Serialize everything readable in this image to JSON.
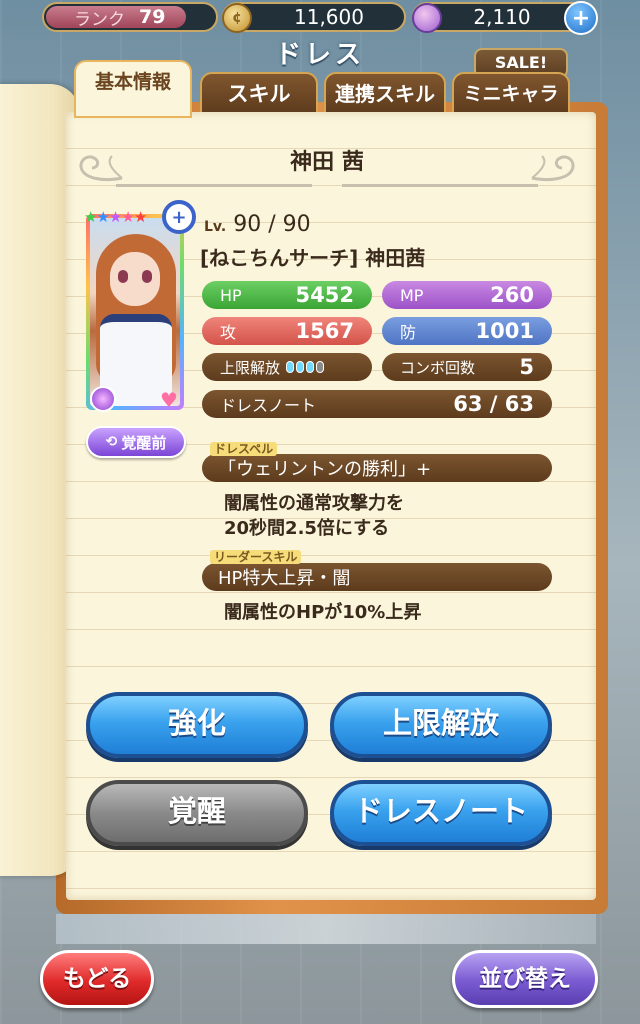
{
  "header": {
    "rank_label": "ランク",
    "rank_value": "79",
    "coins": "11,600",
    "gems": "2,110",
    "screen_title": "ドレス",
    "sale_label": "SALE!"
  },
  "tabs": [
    {
      "label": "基本情報"
    },
    {
      "label": "スキル"
    },
    {
      "label": "連携スキル"
    },
    {
      "label": "ミニキャラ"
    }
  ],
  "character": {
    "name": "神田 茜",
    "stars": "★★★★★",
    "level_label": "Lv.",
    "level": "90 / 90",
    "card_title": "[ねこちんサーチ] 神田茜",
    "awaken_before_label": "覚醒前"
  },
  "stats": {
    "hp_label": "HP",
    "hp": "5452",
    "mp_label": "MP",
    "mp": "260",
    "atk_label": "攻",
    "atk": "1567",
    "def_label": "防",
    "def": "1001",
    "limit_label": "上限解放",
    "limit_level": 3,
    "limit_max": 4,
    "combo_label": "コンボ回数",
    "combo": "5",
    "dressnote_label": "ドレスノート",
    "dressnote": "63 / 63"
  },
  "dress_spell": {
    "tag": "ドレスペル",
    "name": "「ウェリントンの勝利」+",
    "desc_line1": "闇属性の通常攻撃力を",
    "desc_line2": "20秒間2.5倍にする"
  },
  "leader_skill": {
    "tag": "リーダースキル",
    "name": "HP特大上昇・闇",
    "desc": "闇属性のHPが10%上昇"
  },
  "buttons": {
    "enhance": "強化",
    "limit_break": "上限解放",
    "awaken": "覚醒",
    "dress_note": "ドレスノート",
    "back": "もどる",
    "sort": "並び替え"
  },
  "icons": {
    "coin": "coin-icon",
    "gem": "gem-icon",
    "plus": "plus-icon",
    "zoom": "zoom-icon",
    "swirl": "swirl-icon",
    "heart": "heart-icon",
    "refresh": "refresh-icon"
  },
  "colors": {
    "hp": "#3aa534",
    "mp": "#9d52c8",
    "atk": "#d4534a",
    "def": "#4f74c4",
    "button_blue": "#1f7fd6",
    "button_gray": "#8a8a8a",
    "back_red": "#e02a2a",
    "sort_purple": "#7a5ad1"
  }
}
